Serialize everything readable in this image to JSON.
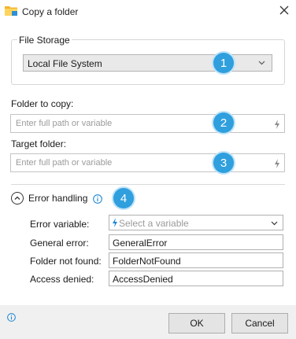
{
  "window": {
    "title": "Copy a folder"
  },
  "file_storage": {
    "legend": "File Storage",
    "selected": "Local File System"
  },
  "folder_to_copy": {
    "label": "Folder to copy:",
    "placeholder": "Enter full path or variable"
  },
  "target_folder": {
    "label": "Target folder:",
    "placeholder": "Enter full path or variable"
  },
  "badges": [
    "1",
    "2",
    "3",
    "4"
  ],
  "error_handling": {
    "label": "Error handling",
    "error_variable": {
      "label": "Error variable:",
      "placeholder": "Select a variable"
    },
    "general_error": {
      "label": "General error:",
      "value": "GeneralError"
    },
    "folder_not_found": {
      "label": "Folder not found:",
      "value": "FolderNotFound"
    },
    "access_denied": {
      "label": "Access denied:",
      "value": "AccessDenied"
    }
  },
  "footer": {
    "ok_label": "OK",
    "cancel_label": "Cancel"
  },
  "colors": {
    "badge": "#2f9fde",
    "info": "#1e88d6",
    "footer_bg": "#f0f0f0"
  },
  "icons": [
    "folder-icon",
    "close-icon",
    "chevron-down-icon",
    "variable-icon",
    "collapse-up-icon",
    "info-icon",
    "lightning-icon"
  ]
}
